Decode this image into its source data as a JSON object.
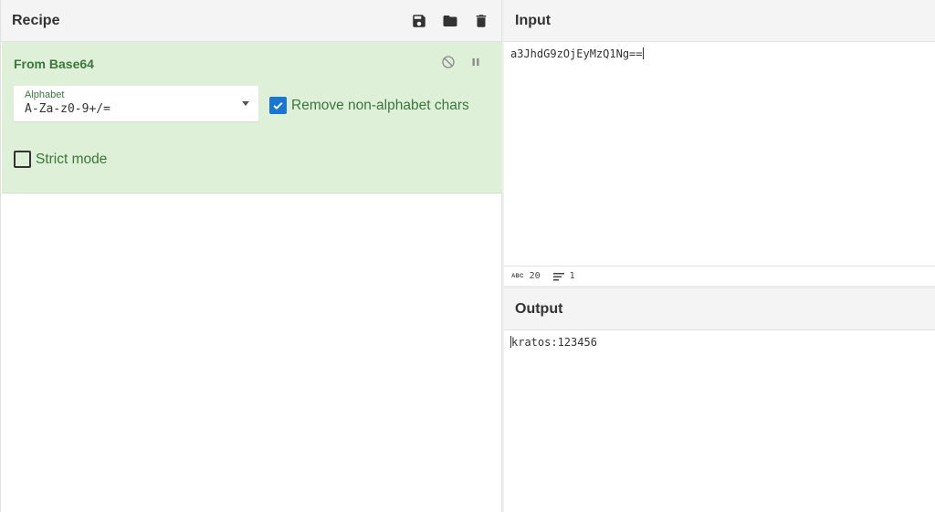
{
  "recipe": {
    "title": "Recipe",
    "icons": [
      "save-icon",
      "folder-icon",
      "trash-icon"
    ]
  },
  "operation": {
    "title": "From Base64",
    "alphabet_label": "Alphabet",
    "alphabet_value": "A-Za-z0-9+/=",
    "remove_nonalpha_label": "Remove non-alphabet chars",
    "remove_nonalpha_checked": true,
    "strict_label": "Strict mode",
    "strict_checked": false
  },
  "input": {
    "title": "Input",
    "text": "a3JhdG9zOjEyMzQ1Ng==",
    "length": "20",
    "lines": "1"
  },
  "output": {
    "title": "Output",
    "text": "kratos:123456"
  },
  "colors": {
    "op_bg": "#dff0d8",
    "op_text": "#3c763d",
    "checkbox": "#1976d2"
  }
}
